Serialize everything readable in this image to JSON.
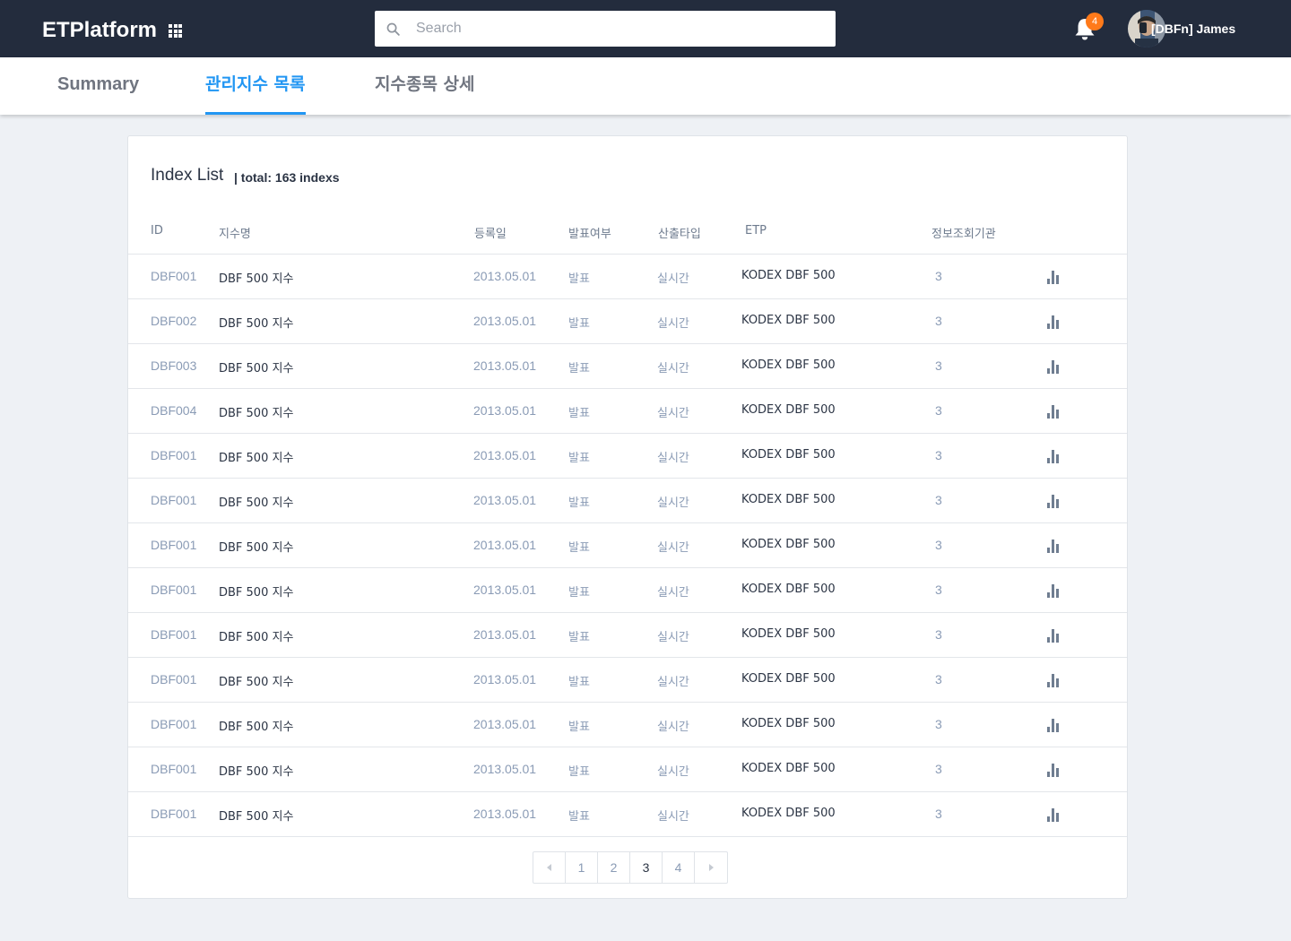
{
  "app": {
    "title": "ETPlatform"
  },
  "search": {
    "placeholder": "Search"
  },
  "notifications": {
    "count": "4"
  },
  "user": {
    "name": "[DBFn] James"
  },
  "tabs": [
    {
      "label": "Summary"
    },
    {
      "label": "관리지수 목록"
    },
    {
      "label": "지수종목 상세"
    }
  ],
  "card": {
    "title": "Index List",
    "total": "| total: 163 indexs"
  },
  "table": {
    "headers": [
      "ID",
      "지수명",
      "등록일",
      "발표여부",
      "산출타입",
      "ETP",
      "정보조회기관"
    ],
    "rows": [
      [
        "DBF001",
        "DBF 500 지수",
        "2013.05.01",
        "발표",
        "실시간",
        "KODEX DBF 500",
        "3"
      ],
      [
        "DBF002",
        "DBF 500 지수",
        "2013.05.01",
        "발표",
        "실시간",
        "KODEX DBF 500",
        "3"
      ],
      [
        "DBF003",
        "DBF 500 지수",
        "2013.05.01",
        "발표",
        "실시간",
        "KODEX DBF 500",
        "3"
      ],
      [
        "DBF004",
        "DBF 500 지수",
        "2013.05.01",
        "발표",
        "실시간",
        "KODEX DBF 500",
        "3"
      ],
      [
        "DBF001",
        "DBF 500 지수",
        "2013.05.01",
        "발표",
        "실시간",
        "KODEX DBF 500",
        "3"
      ],
      [
        "DBF001",
        "DBF 500 지수",
        "2013.05.01",
        "발표",
        "실시간",
        "KODEX DBF 500",
        "3"
      ],
      [
        "DBF001",
        "DBF 500 지수",
        "2013.05.01",
        "발표",
        "실시간",
        "KODEX DBF 500",
        "3"
      ],
      [
        "DBF001",
        "DBF 500 지수",
        "2013.05.01",
        "발표",
        "실시간",
        "KODEX DBF 500",
        "3"
      ],
      [
        "DBF001",
        "DBF 500 지수",
        "2013.05.01",
        "발표",
        "실시간",
        "KODEX DBF 500",
        "3"
      ],
      [
        "DBF001",
        "DBF 500 지수",
        "2013.05.01",
        "발표",
        "실시간",
        "KODEX DBF 500",
        "3"
      ],
      [
        "DBF001",
        "DBF 500 지수",
        "2013.05.01",
        "발표",
        "실시간",
        "KODEX DBF 500",
        "3"
      ],
      [
        "DBF001",
        "DBF 500 지수",
        "2013.05.01",
        "발표",
        "실시간",
        "KODEX DBF 500",
        "3"
      ],
      [
        "DBF001",
        "DBF 500 지수",
        "2013.05.01",
        "발표",
        "실시간",
        "KODEX DBF 500",
        "3"
      ]
    ],
    "row_icon": "bar-chart-icon"
  },
  "pagination": {
    "pages": [
      "1",
      "2",
      "3",
      "4"
    ],
    "current": "3"
  },
  "colors": {
    "topbar": "#232c3d",
    "accent": "#2196f3",
    "badge": "#ff7a1a"
  }
}
